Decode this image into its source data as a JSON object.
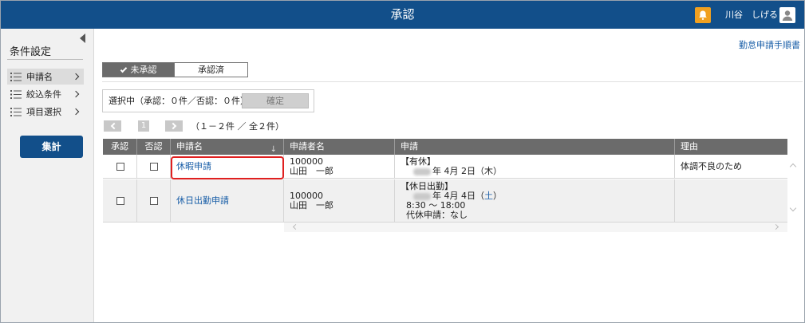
{
  "header": {
    "title": "承認",
    "user_name": "川谷　しげる"
  },
  "sidebar": {
    "title": "条件設定",
    "items": [
      {
        "label": "申請名"
      },
      {
        "label": "絞込条件"
      },
      {
        "label": "項目選択"
      }
    ],
    "aggregate_button": "集計"
  },
  "top_link": "勤怠申請手順書",
  "tabs": [
    {
      "label": "未承認",
      "selected": true
    },
    {
      "label": "承認済",
      "selected": false
    }
  ],
  "selection": {
    "text": "選択中（承認：０件／否認：０件）",
    "confirm_button": "確定"
  },
  "pager": {
    "page": "1",
    "info": "（１－２件 ／ 全２件）"
  },
  "table": {
    "headers": [
      "承認",
      "否認",
      "申請名",
      "申請者名",
      "申請",
      "理由"
    ],
    "sort_icon": "↓",
    "rows": [
      {
        "name": "休暇申請",
        "applicant_id": "100000",
        "applicant_name": "山田　一郎",
        "detail_1": "【有休】",
        "detail_2": "年 4月 2日（木）",
        "reason": "体調不良のため"
      },
      {
        "name": "休日出勤申請",
        "applicant_id": "100000",
        "applicant_name": "山田　一郎",
        "detail_1": "【休日出勤】",
        "detail_2": "年 4月 4日（",
        "detail_2_day": "土",
        "detail_2_end": "）",
        "detail_3": "8:30 ～ 18:00",
        "detail_4": "代休申請：なし",
        "reason": ""
      }
    ]
  },
  "colors": {
    "header_bg": "#124f8a",
    "bell_bg": "#f0a020",
    "link": "#1a5fa8",
    "highlight": "#e02020"
  }
}
